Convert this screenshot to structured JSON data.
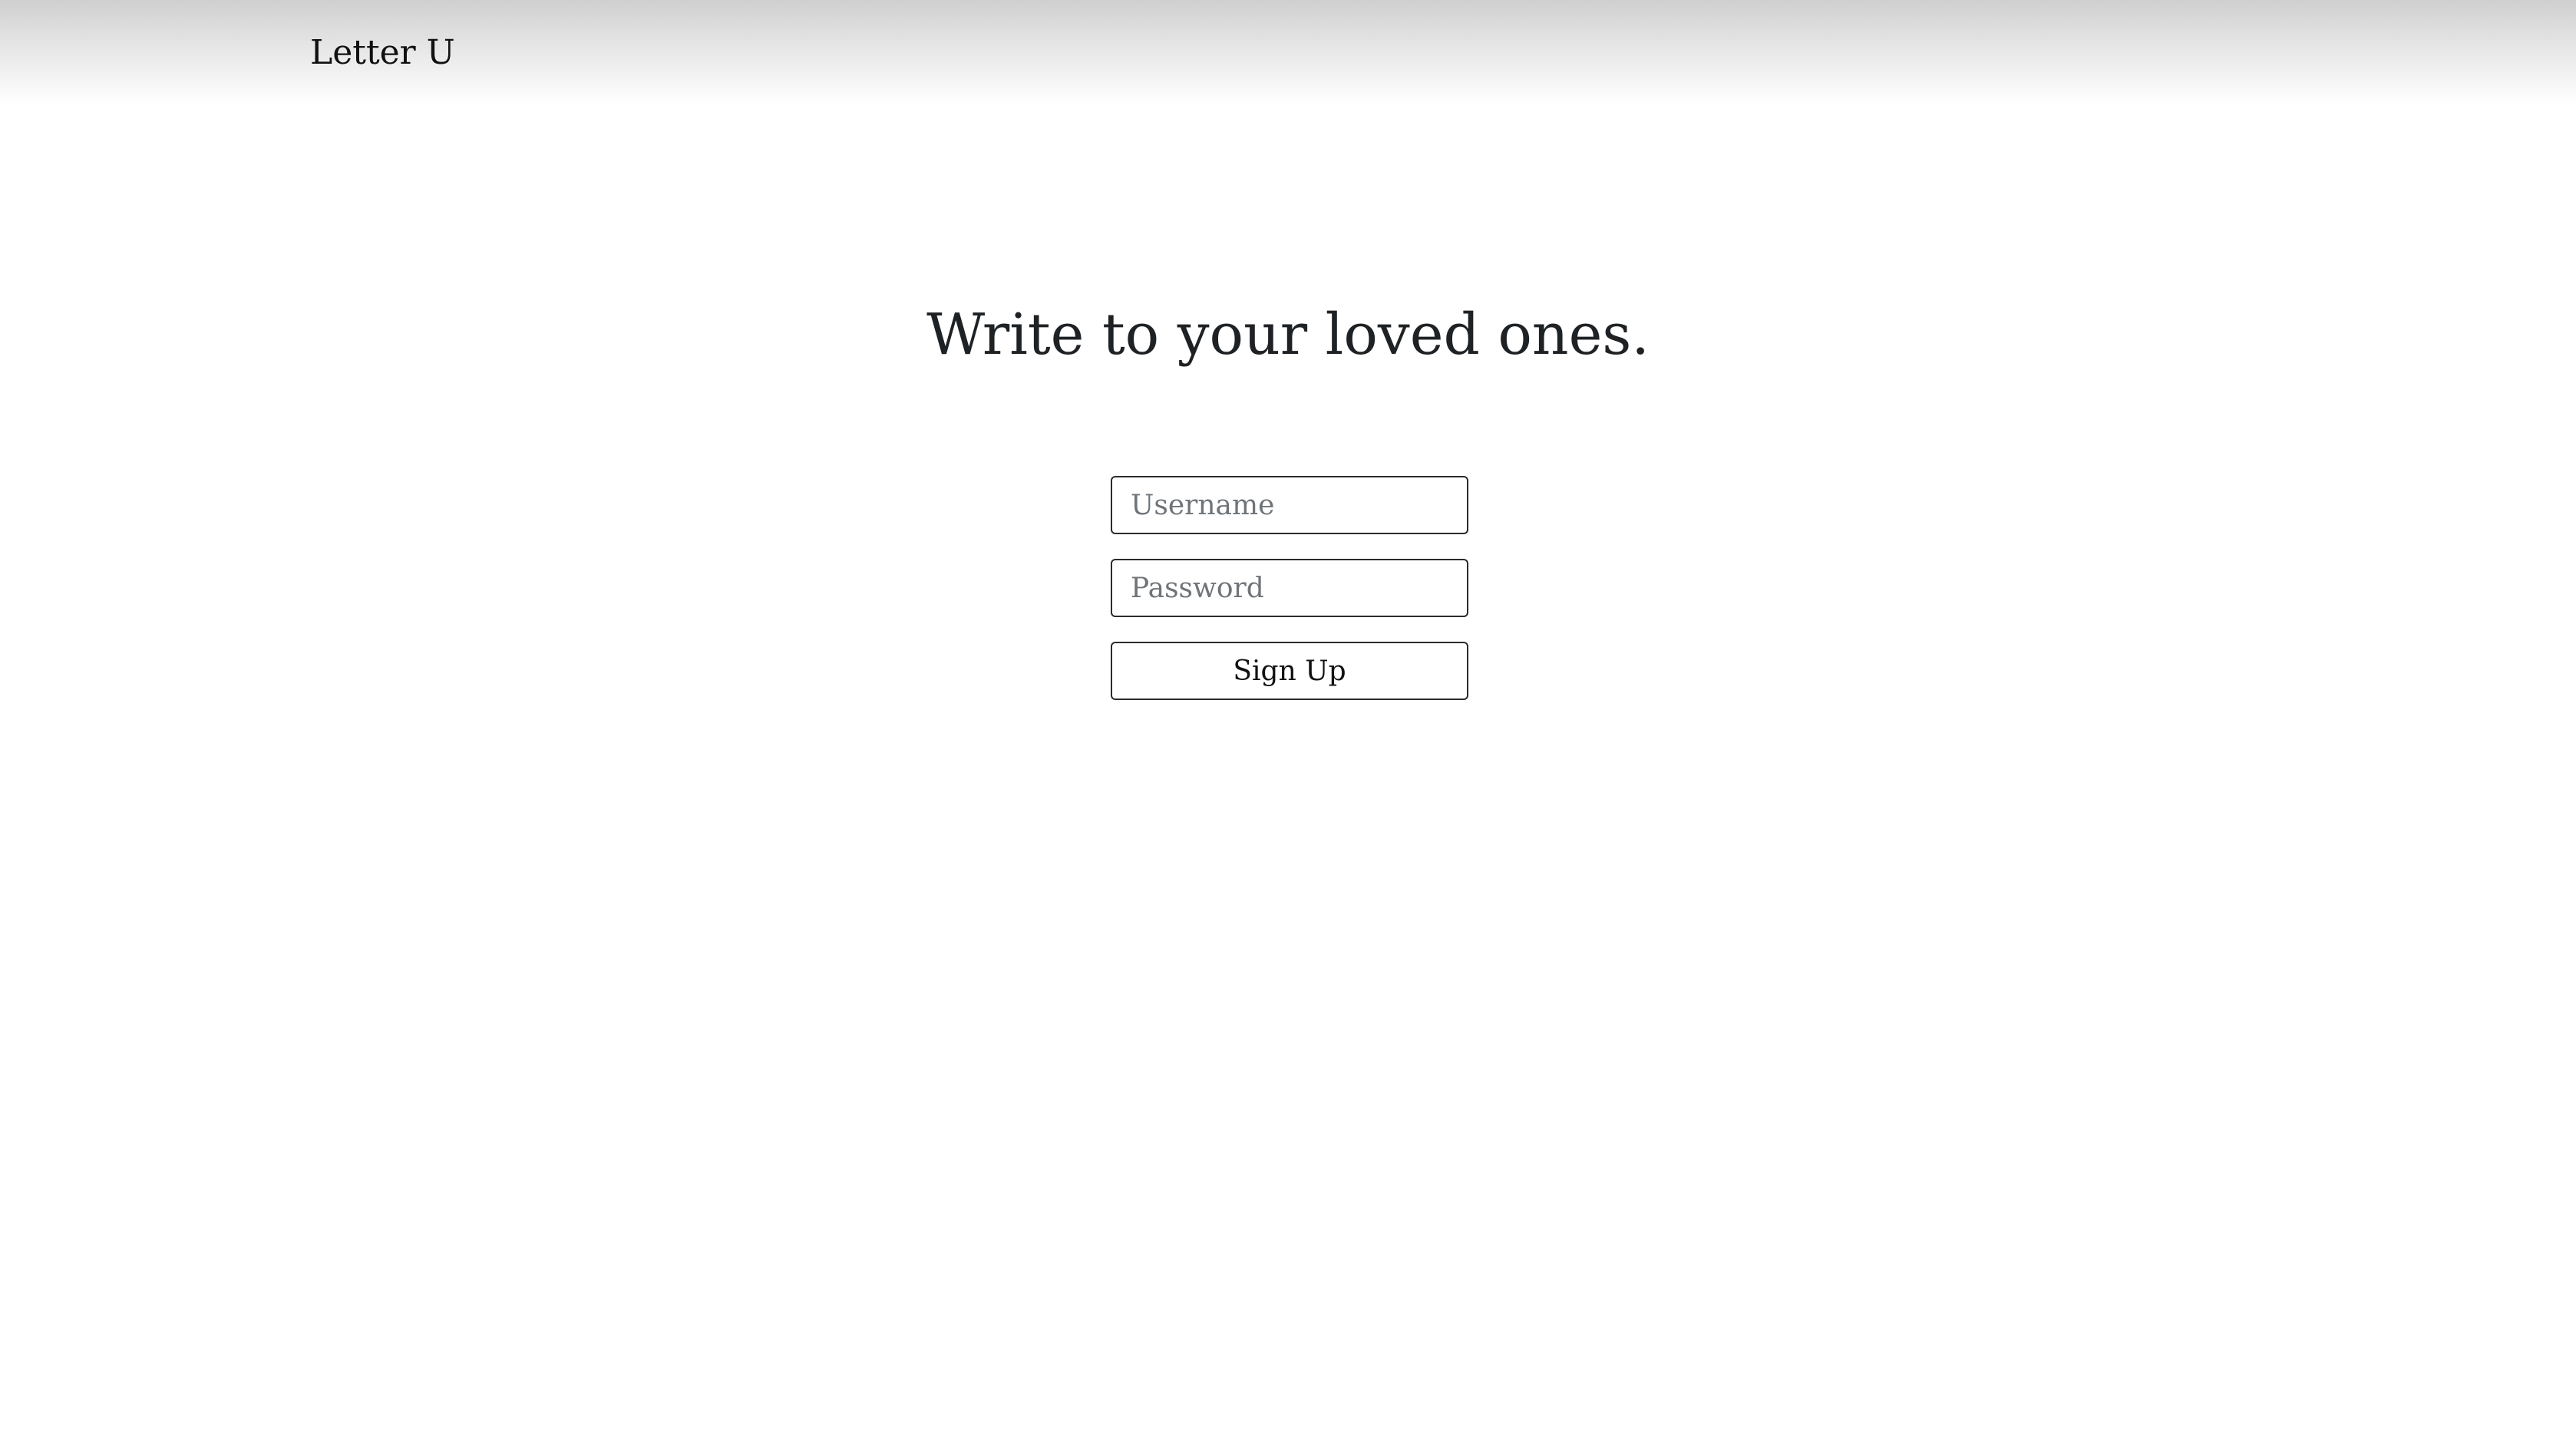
{
  "header": {
    "brand": "Letter U"
  },
  "hero": {
    "title": "Write to your loved ones."
  },
  "signup_form": {
    "username": {
      "value": "",
      "placeholder": "Username"
    },
    "password": {
      "value": "",
      "placeholder": "Password"
    },
    "submit_label": "Sign Up"
  }
}
